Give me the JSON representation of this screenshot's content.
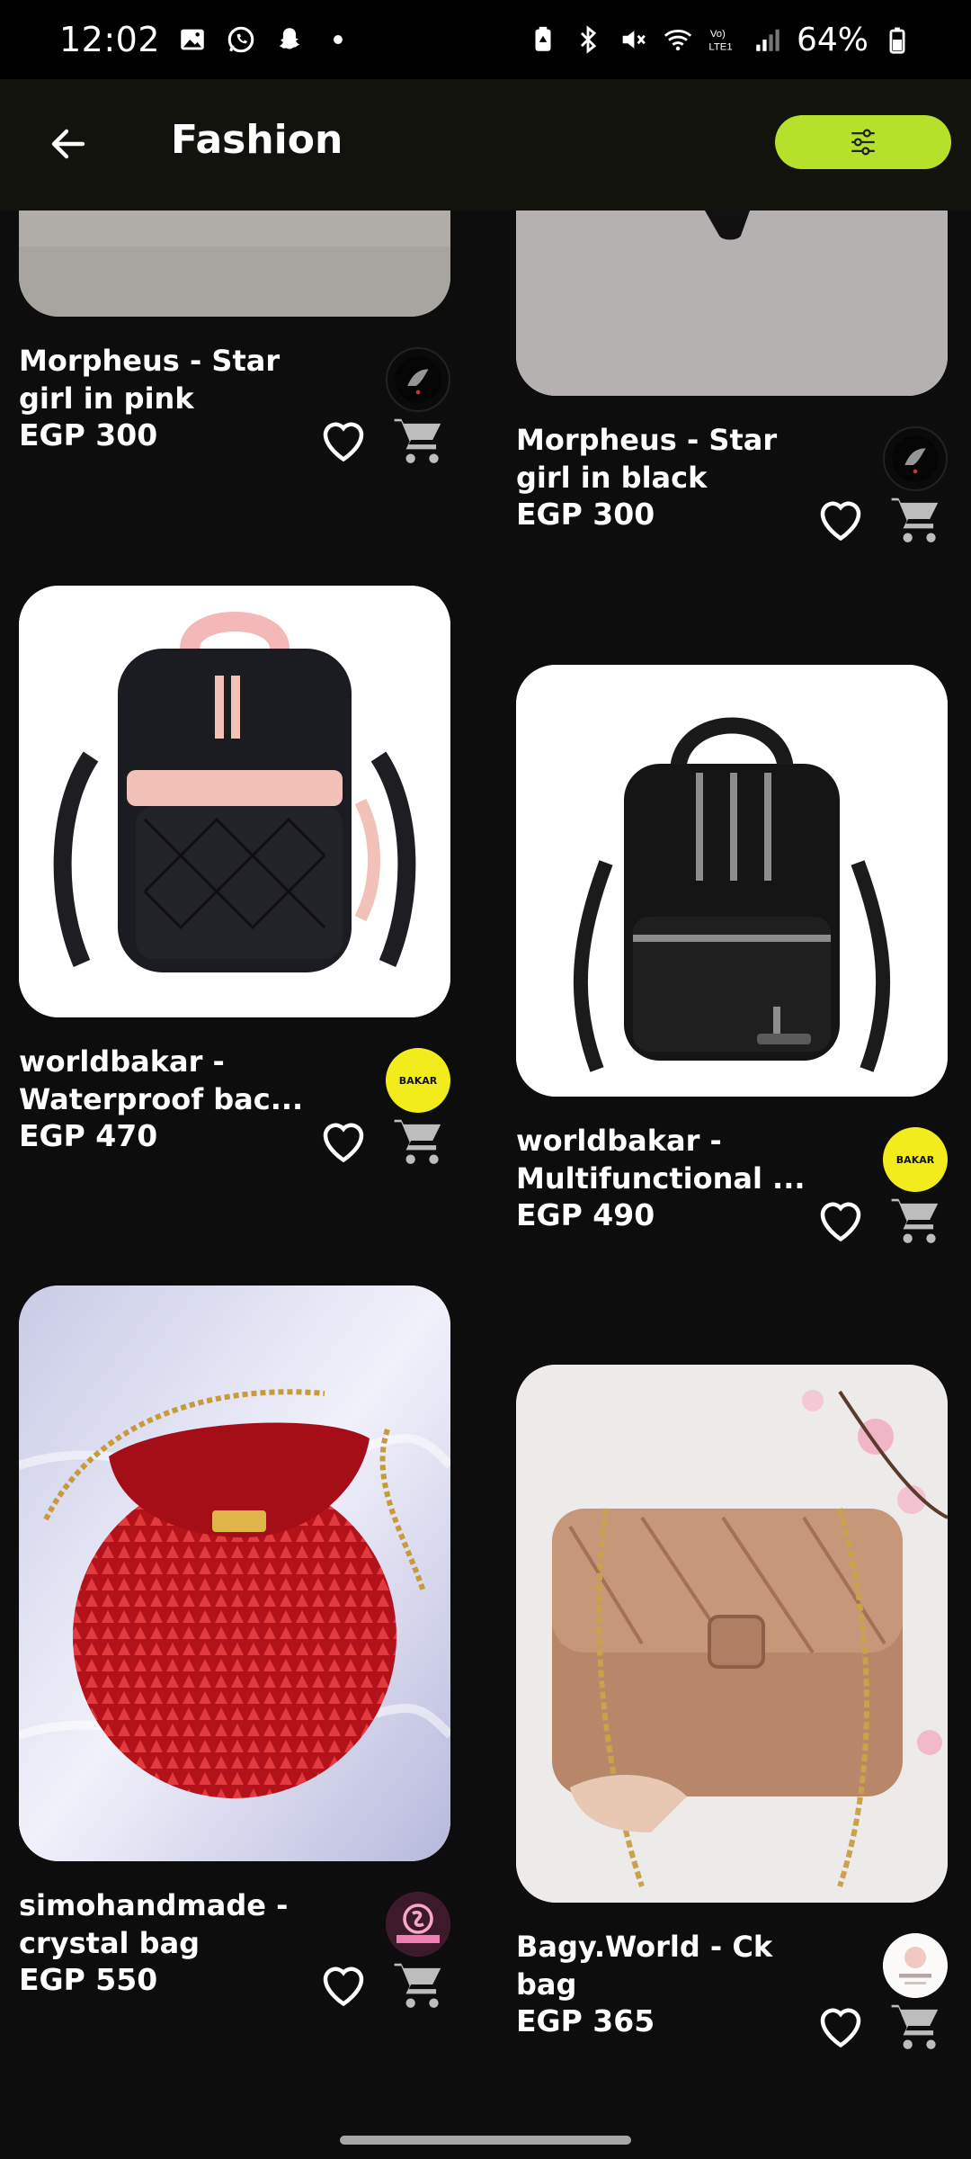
{
  "status_bar": {
    "time": "12:02",
    "battery": "64%",
    "icons_left": [
      "gallery-icon",
      "whatsapp-icon",
      "snapchat-icon",
      "dot-icon"
    ],
    "icons_right": [
      "battery-saver-icon",
      "bluetooth-icon",
      "mute-icon",
      "wifi-icon",
      "volte-icon",
      "signal-icon",
      "battery-icon"
    ]
  },
  "header": {
    "title": "Fashion",
    "back_icon": "back-arrow-icon",
    "filter_icon": "sliders-icon",
    "accent": "#b6e12a"
  },
  "products": [
    {
      "name": "Morpheus - Star girl in pink",
      "price": "EGP 300",
      "store": "Morpheus"
    },
    {
      "name": "Morpheus - Star girl in black",
      "price": "EGP 300",
      "store": "Morpheus"
    },
    {
      "name": "worldbakar - Waterproof bac...",
      "price": "EGP 470",
      "store": "BAKAR"
    },
    {
      "name": "worldbakar - Multifunctional ...",
      "price": "EGP 490",
      "store": "BAKAR"
    },
    {
      "name": "simohandmade - crystal bag",
      "price": "EGP 550",
      "store": "simohandmade"
    },
    {
      "name": "Bagy.World - Ck bag",
      "price": "EGP 365",
      "store": "BAGY.WORLD"
    }
  ],
  "logos": {
    "bakar_text": "BAKAR"
  }
}
